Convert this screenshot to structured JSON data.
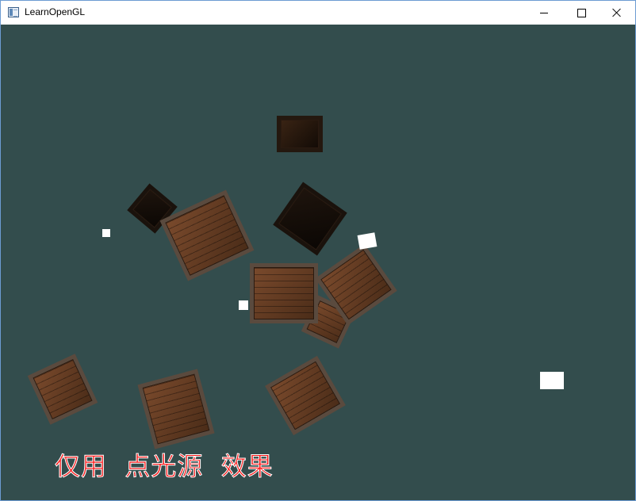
{
  "window": {
    "title": "LearnOpenGL",
    "icon": "app-window-icon",
    "controls": [
      "minimize-icon",
      "maximize-icon",
      "close-icon"
    ]
  },
  "scene": {
    "background": "#334d4d",
    "object_kind": "wooden crate",
    "crate_count": 10,
    "light_source_count": 4,
    "light_color": "#ffffff",
    "caption": "仅用  点光源  效果",
    "caption_color": "#ff1a1a"
  }
}
